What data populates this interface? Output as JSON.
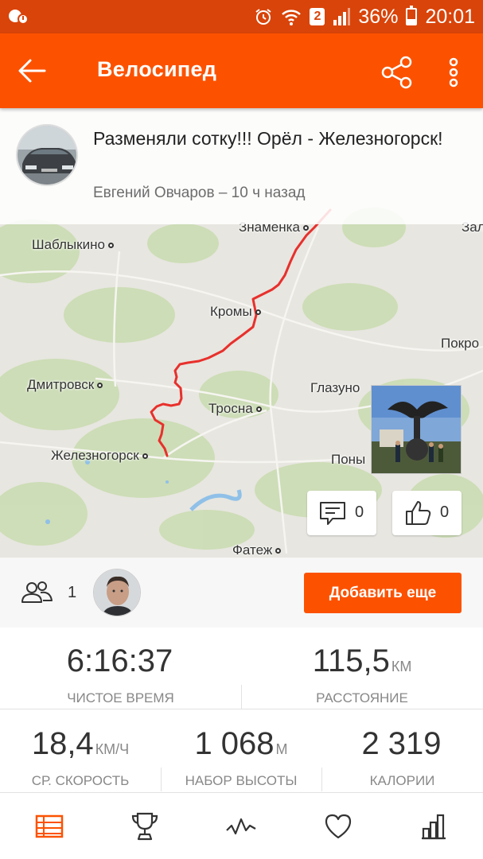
{
  "status_bar": {
    "battery_percent": "36%",
    "battery_level": 0.36,
    "time": "20:01",
    "sim_badge": "2",
    "icons": [
      "notification-icon",
      "alarm-icon",
      "wifi-icon",
      "signal-icon",
      "battery-icon"
    ]
  },
  "app_bar": {
    "title": "Велосипед",
    "icons": [
      "back-arrow-icon",
      "share-icon",
      "more-vert-icon"
    ]
  },
  "activity": {
    "title": "Разменяли сотку!!! Орёл - Железногорск!",
    "athlete": "Евгений Овчаров",
    "time_ago": "10 ч назад",
    "subtitle": "Евгений Овчаров – 10 ч назад"
  },
  "map": {
    "places": [
      {
        "name": "Знаменка"
      },
      {
        "name": "Шаблыкино"
      },
      {
        "name": "Кромы"
      },
      {
        "name": "Покро"
      },
      {
        "name": "Дмитровск"
      },
      {
        "name": "Глазуно"
      },
      {
        "name": "Тросна"
      },
      {
        "name": "Железногорск"
      },
      {
        "name": "Поны"
      },
      {
        "name": "Фатеж"
      },
      {
        "name": "Зал"
      }
    ],
    "route_color": "#e8302c"
  },
  "social": {
    "comments": "0",
    "kudos": "0"
  },
  "athletes": {
    "count": "1",
    "add_button": "Добавить еще"
  },
  "stats": {
    "moving_time": {
      "value": "6:16:37",
      "unit": "",
      "label": "ЧИСТОЕ ВРЕМЯ"
    },
    "distance": {
      "value": "115,5",
      "unit": "КМ",
      "label": "РАССТОЯНИЕ"
    },
    "avg_speed": {
      "value": "18,4",
      "unit": "КМ/Ч",
      "label": "СР. СКОРОСТЬ"
    },
    "elevation": {
      "value": "1 068",
      "unit": "М",
      "label": "НАБОР ВЫСОТЫ"
    },
    "calories": {
      "value": "2 319",
      "unit": "",
      "label": "КАЛОРИИ"
    }
  },
  "bottom_nav": {
    "items": [
      "feed-icon",
      "trophy-icon",
      "activity-pulse-icon",
      "heart-icon",
      "stats-bars-icon"
    ],
    "active": "feed-icon"
  },
  "colors": {
    "brand": "#fc5200",
    "status_bar": "#d9440a"
  }
}
